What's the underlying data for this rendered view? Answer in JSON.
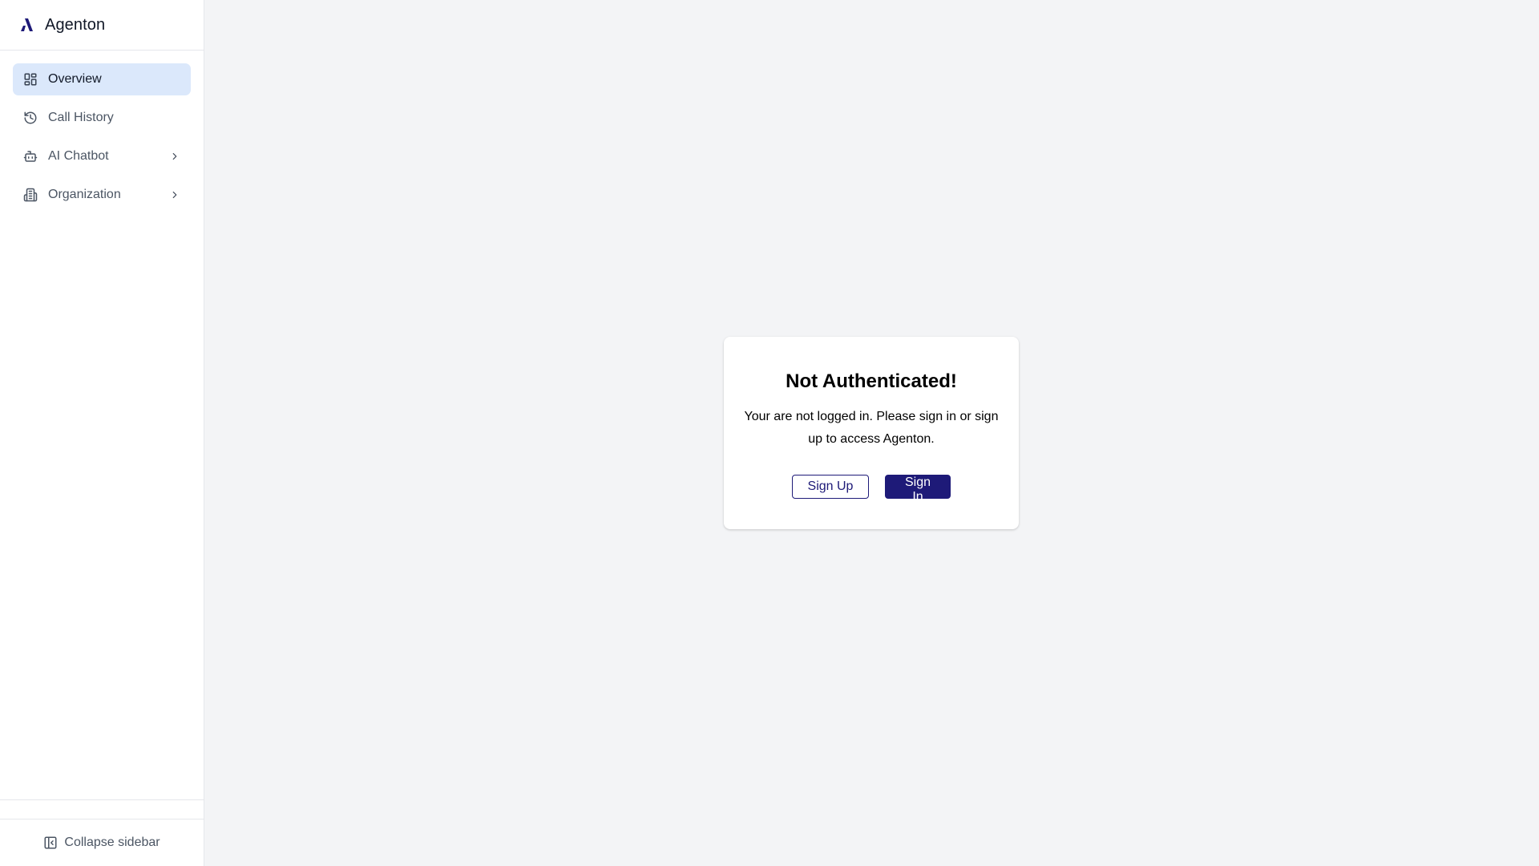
{
  "brand": {
    "name": "Agenton",
    "logo_color": "#1e1a78"
  },
  "sidebar": {
    "items": [
      {
        "label": "Overview",
        "icon": "dashboard-icon",
        "active": true
      },
      {
        "label": "Call History",
        "icon": "history-icon",
        "active": false
      },
      {
        "label": "AI Chatbot",
        "icon": "bot-icon",
        "active": false,
        "expandable": true
      },
      {
        "label": "Organization",
        "icon": "building-icon",
        "active": false,
        "expandable": true
      }
    ],
    "collapse_label": "Collapse sidebar"
  },
  "auth_card": {
    "title": "Not Authenticated!",
    "message": "Your are not logged in. Please sign in or sign up to access Agenton.",
    "sign_up_label": "Sign Up",
    "sign_in_label": "Sign In"
  },
  "colors": {
    "accent": "#1e1a78",
    "active_nav_bg": "#dbe8fb",
    "page_bg": "#f3f4f6"
  }
}
